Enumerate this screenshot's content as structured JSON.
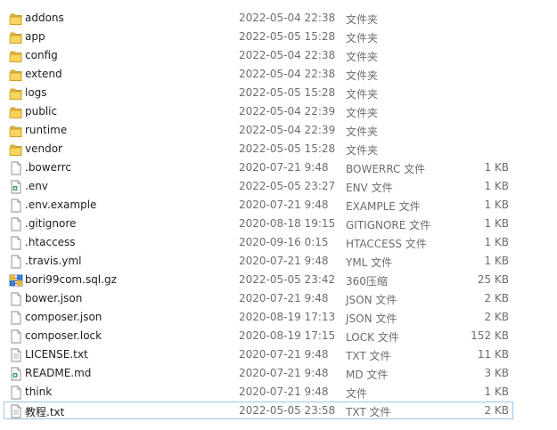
{
  "files": [
    {
      "name": "addons",
      "date": "2022-05-04 22:38",
      "type": "文件夹",
      "size": "",
      "icon": "folder-icon"
    },
    {
      "name": "app",
      "date": "2022-05-05 15:28",
      "type": "文件夹",
      "size": "",
      "icon": "folder-icon"
    },
    {
      "name": "config",
      "date": "2022-05-04 22:38",
      "type": "文件夹",
      "size": "",
      "icon": "folder-icon"
    },
    {
      "name": "extend",
      "date": "2022-05-04 22:38",
      "type": "文件夹",
      "size": "",
      "icon": "folder-icon"
    },
    {
      "name": "logs",
      "date": "2022-05-05 15:28",
      "type": "文件夹",
      "size": "",
      "icon": "folder-icon"
    },
    {
      "name": "public",
      "date": "2022-05-04 22:39",
      "type": "文件夹",
      "size": "",
      "icon": "folder-icon"
    },
    {
      "name": "runtime",
      "date": "2022-05-04 22:39",
      "type": "文件夹",
      "size": "",
      "icon": "folder-icon"
    },
    {
      "name": "vendor",
      "date": "2022-05-05 15:28",
      "type": "文件夹",
      "size": "",
      "icon": "folder-icon"
    },
    {
      "name": ".bowerrc",
      "date": "2020-07-21 9:48",
      "type": "BOWERRC 文件",
      "size": "1 KB",
      "icon": "file-icon"
    },
    {
      "name": ".env",
      "date": "2022-05-05 23:27",
      "type": "ENV 文件",
      "size": "1 KB",
      "icon": "env-file-icon"
    },
    {
      "name": ".env.example",
      "date": "2020-07-21 9:48",
      "type": "EXAMPLE 文件",
      "size": "1 KB",
      "icon": "file-icon"
    },
    {
      "name": ".gitignore",
      "date": "2020-08-18 19:15",
      "type": "GITIGNORE 文件",
      "size": "1 KB",
      "icon": "file-icon"
    },
    {
      "name": ".htaccess",
      "date": "2020-09-16 0:15",
      "type": "HTACCESS 文件",
      "size": "1 KB",
      "icon": "file-icon"
    },
    {
      "name": ".travis.yml",
      "date": "2020-07-21 9:48",
      "type": "YML 文件",
      "size": "1 KB",
      "icon": "file-icon"
    },
    {
      "name": "bori99com.sql.gz",
      "date": "2022-05-05 23:42",
      "type": "360压缩",
      "size": "25 KB",
      "icon": "archive-icon"
    },
    {
      "name": "bower.json",
      "date": "2020-07-21 9:48",
      "type": "JSON 文件",
      "size": "2 KB",
      "icon": "file-icon"
    },
    {
      "name": "composer.json",
      "date": "2020-08-19 17:13",
      "type": "JSON 文件",
      "size": "2 KB",
      "icon": "file-icon"
    },
    {
      "name": "composer.lock",
      "date": "2020-08-19 17:15",
      "type": "LOCK 文件",
      "size": "152 KB",
      "icon": "file-icon"
    },
    {
      "name": "LICENSE.txt",
      "date": "2020-07-21 9:48",
      "type": "TXT 文件",
      "size": "11 KB",
      "icon": "text-file-icon"
    },
    {
      "name": "README.md",
      "date": "2020-07-21 9:48",
      "type": "MD 文件",
      "size": "3 KB",
      "icon": "env-file-icon"
    },
    {
      "name": "think",
      "date": "2020-07-21 9:48",
      "type": "文件",
      "size": "1 KB",
      "icon": "file-icon"
    },
    {
      "name": "教程.txt",
      "date": "2022-05-05 23:58",
      "type": "TXT 文件",
      "size": "2 KB",
      "icon": "text-file-icon",
      "selected": true
    }
  ]
}
